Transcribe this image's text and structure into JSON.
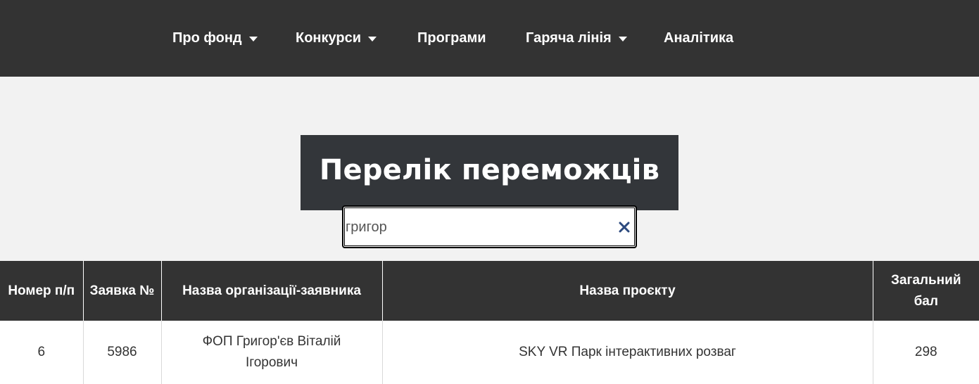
{
  "nav": {
    "items": [
      {
        "label": "Про фонд",
        "has_dropdown": true
      },
      {
        "label": "Конкурси",
        "has_dropdown": true
      },
      {
        "label": "Програми",
        "has_dropdown": false
      },
      {
        "label": "Гаряча лінія",
        "has_dropdown": true
      },
      {
        "label": "Аналітика",
        "has_dropdown": false
      }
    ]
  },
  "page": {
    "title": "Перелік переможців"
  },
  "search": {
    "value": "григор",
    "clear_icon": "close-icon"
  },
  "table": {
    "headers": [
      "Номер п/п",
      "Заявка №",
      "Назва організації-заявника",
      "Назва проєкту",
      "Загальний бал"
    ],
    "rows": [
      [
        "6",
        "5986",
        "ФОП Григор'єв Віталій Ігорович",
        "SKY VR Парк інтерактивних розваг",
        "298"
      ]
    ]
  },
  "colors": {
    "nav_bg": "#333333",
    "hero_bg": "#f2f2f2",
    "title_bg": "#33363a",
    "clear_icon": "#2c4a7e"
  }
}
